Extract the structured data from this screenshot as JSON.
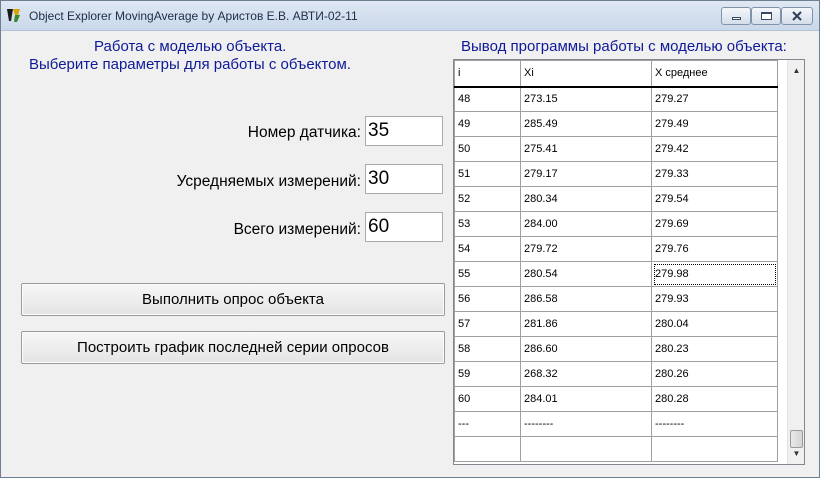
{
  "window": {
    "title": "Object Explorer MovingAverage by Аристов Е.В. АВТИ-02-11",
    "controls": {
      "minimize_icon": "minimize-icon",
      "maximize_icon": "maximize-icon",
      "close_icon": "close-icon"
    }
  },
  "left_panel": {
    "heading_line1": "Работа с моделью объекта.",
    "heading_line2": "Выберите параметры для работы с объектом.",
    "fields": [
      {
        "label": "Номер датчика:",
        "value": "35"
      },
      {
        "label": "Усредняемых измерений:",
        "value": "30"
      },
      {
        "label": "Всего измерений:",
        "value": "60"
      }
    ],
    "buttons": {
      "poll": "Выполнить опрос объекта",
      "plot": "Построить график последней серии опросов"
    }
  },
  "right_panel": {
    "heading": "Вывод программы работы с моделью объекта:",
    "columns": [
      "i",
      "Xi",
      "X среднее"
    ],
    "rows": [
      [
        "48",
        "273.15",
        "279.27"
      ],
      [
        "49",
        "285.49",
        "279.49"
      ],
      [
        "50",
        "275.41",
        "279.42"
      ],
      [
        "51",
        "279.17",
        "279.33"
      ],
      [
        "52",
        "280.34",
        "279.54"
      ],
      [
        "53",
        "284.00",
        "279.69"
      ],
      [
        "54",
        "279.72",
        "279.76"
      ],
      [
        "55",
        "280.54",
        "279.98"
      ],
      [
        "56",
        "286.58",
        "279.93"
      ],
      [
        "57",
        "281.86",
        "280.04"
      ],
      [
        "58",
        "286.60",
        "280.23"
      ],
      [
        "59",
        "268.32",
        "280.26"
      ],
      [
        "60",
        "284.01",
        "280.28"
      ],
      [
        "---",
        "--------",
        "--------"
      ],
      [
        "",
        "",
        ""
      ]
    ],
    "focused_cell": "55 / X среднее"
  },
  "colors": {
    "heading": "#0f1a98",
    "titlebar": "#c9d8ea"
  }
}
